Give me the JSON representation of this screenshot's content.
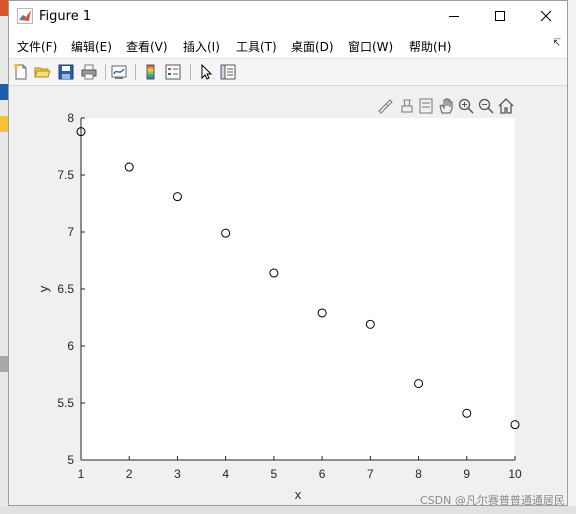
{
  "window": {
    "title": "Figure 1",
    "controls": [
      "minimize",
      "maximize",
      "close"
    ]
  },
  "menubar": {
    "items": [
      {
        "label": "文件(F)"
      },
      {
        "label": "编辑(E)"
      },
      {
        "label": "查看(V)"
      },
      {
        "label": "插入(I)"
      },
      {
        "label": "工具(T)"
      },
      {
        "label": "桌面(D)"
      },
      {
        "label": "窗口(W)"
      },
      {
        "label": "帮助(H)"
      }
    ],
    "overflow_icon": "dock-arrow-icon"
  },
  "toolbar": {
    "buttons": [
      "new-figure-icon",
      "open-file-icon",
      "save-icon",
      "print-icon",
      "link-plot-icon",
      "colorbar-icon",
      "legend-icon",
      "edit-plot-arrow-icon",
      "property-inspector-icon"
    ]
  },
  "axes_toolbar": {
    "buttons": [
      "brush-icon",
      "data-tips-icon",
      "rotate-icon",
      "pan-hand-icon",
      "zoom-in-icon",
      "zoom-out-icon",
      "home-icon"
    ]
  },
  "chart_data": {
    "type": "scatter",
    "x": [
      1,
      2,
      3,
      4,
      5,
      6,
      7,
      8,
      9,
      10
    ],
    "y": [
      7.88,
      7.57,
      7.31,
      6.99,
      6.64,
      6.29,
      6.19,
      5.67,
      5.41,
      5.31
    ],
    "xlabel": "x",
    "ylabel": "y",
    "xlim": [
      1,
      10
    ],
    "ylim": [
      5,
      8
    ],
    "xticks": [
      "1",
      "2",
      "3",
      "4",
      "5",
      "6",
      "7",
      "8",
      "9",
      "10"
    ],
    "yticks": [
      "5",
      "5.5",
      "6",
      "6.5",
      "7",
      "7.5",
      "8"
    ],
    "marker": "open-circle",
    "marker_color": "#000000",
    "grid": false,
    "background": "#ffffff"
  },
  "watermark": "CSDN @凡尔赛普普通通居民"
}
